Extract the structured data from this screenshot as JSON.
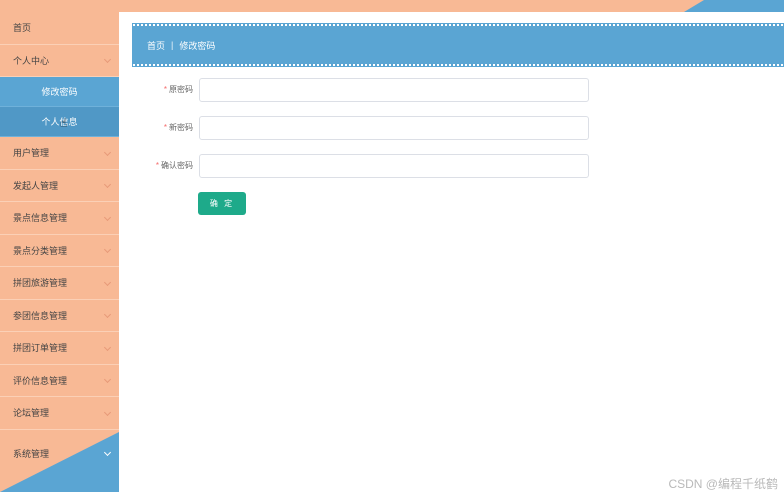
{
  "sidebar": {
    "items": [
      {
        "label": "首页"
      },
      {
        "label": "个人中心"
      },
      {
        "label": "用户管理"
      },
      {
        "label": "发起人管理"
      },
      {
        "label": "景点信息管理"
      },
      {
        "label": "景点分类管理"
      },
      {
        "label": "拼团旅游管理"
      },
      {
        "label": "参团信息管理"
      },
      {
        "label": "拼团订单管理"
      },
      {
        "label": "评价信息管理"
      },
      {
        "label": "论坛管理"
      },
      {
        "label": "系统管理"
      }
    ],
    "sub_items": [
      {
        "label": "修改密码"
      },
      {
        "label": "个人信息"
      }
    ]
  },
  "breadcrumb": {
    "home": "首页",
    "separator": "|",
    "current": "修改密码"
  },
  "form": {
    "required_mark": "*",
    "old_password_label": "原密码",
    "new_password_label": "新密码",
    "confirm_password_label": "确认密码",
    "submit_label": "确 定"
  },
  "watermark": "CSDN @编程千纸鹤",
  "colors": {
    "sidebar_bg": "#f8b995",
    "accent_blue": "#5aa5d3",
    "button_green": "#1eaa8a"
  }
}
